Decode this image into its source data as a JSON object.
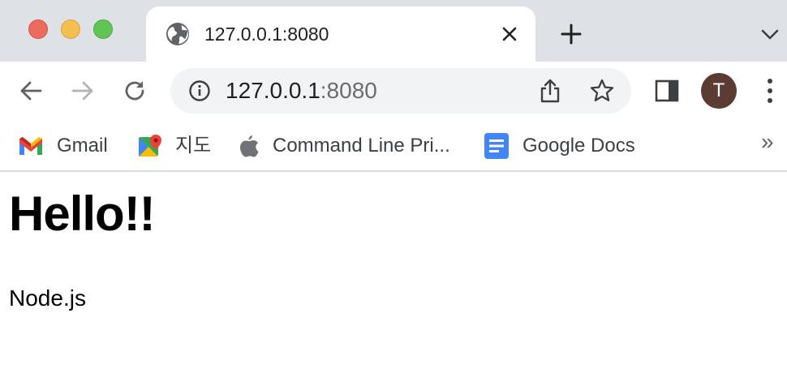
{
  "window": {
    "controls": [
      "close",
      "minimize",
      "maximize"
    ]
  },
  "tab": {
    "title": "127.0.0.1:8080",
    "icon": "globe-icon"
  },
  "toolbar": {
    "url_host": "127.0.0.1",
    "url_port": ":8080",
    "avatar_letter": "T"
  },
  "bookmarks": {
    "items": [
      {
        "label": "Gmail",
        "icon": "gmail-icon"
      },
      {
        "label": "지도",
        "icon": "maps-icon"
      },
      {
        "label": "Command Line Pri...",
        "icon": "apple-icon"
      },
      {
        "label": "Google Docs",
        "icon": "docs-icon"
      }
    ],
    "overflow": "»"
  },
  "page": {
    "heading": "Hello!!",
    "text": "Node.js"
  },
  "colors": {
    "tabstrip": "#dee1e6",
    "omnibox": "#f1f3f4",
    "avatar": "#5b3b32",
    "close": "#ed6a5e",
    "minimize": "#f5bf4f",
    "maximize": "#61c554"
  }
}
